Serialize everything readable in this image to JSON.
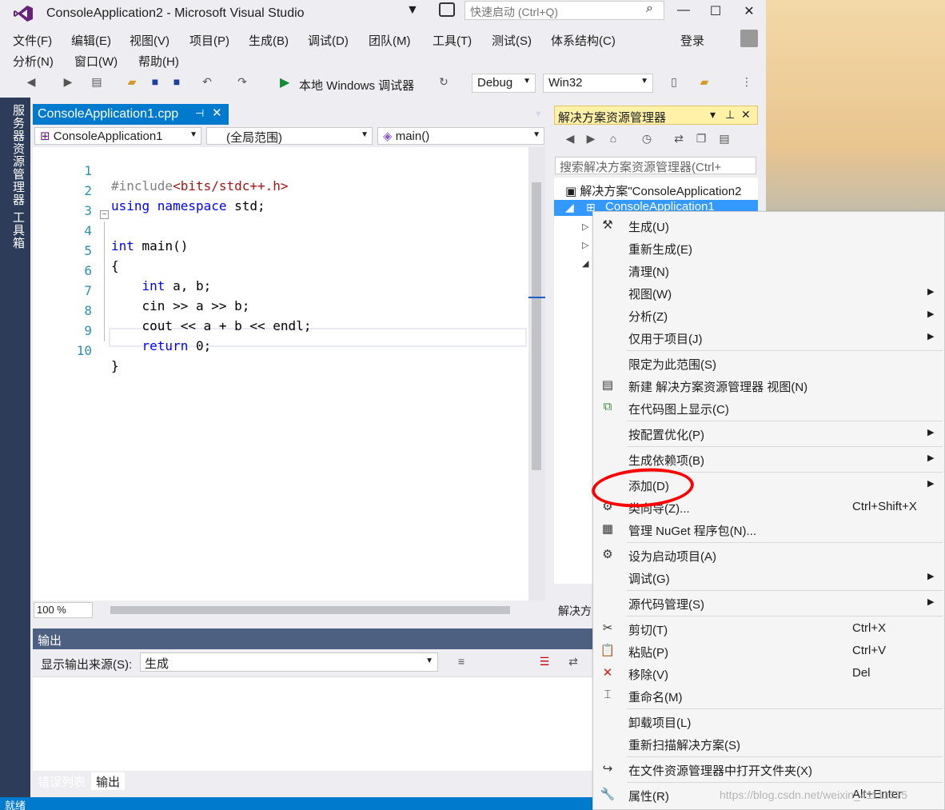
{
  "window": {
    "title": "ConsoleApplication2 - Microsoft Visual Studio",
    "quick_launch_placeholder": "快速启动 (Ctrl+Q)",
    "min": "—",
    "max": "☐",
    "close": "✕"
  },
  "menu": {
    "row1": [
      "文件(F)",
      "编辑(E)",
      "视图(V)",
      "项目(P)",
      "生成(B)",
      "调试(D)",
      "团队(M)",
      "工具(T)",
      "测试(S)",
      "体系结构(C)"
    ],
    "row2": [
      "分析(N)",
      "窗口(W)",
      "帮助(H)"
    ],
    "login": "登录"
  },
  "toolbar": {
    "run_label": "本地 Windows 调试器",
    "config": "Debug",
    "platform": "Win32"
  },
  "left_strip": {
    "server_explorer": "服务器资源管理器",
    "toolbox": "工具箱"
  },
  "editor": {
    "tab": "ConsoleApplication1.cpp",
    "project_combo": "ConsoleApplication1",
    "scope_combo": "(全局范围)",
    "member_combo": "main()",
    "zoom": "100 %",
    "lines": [
      {
        "n": "1",
        "text": "#include<bits/stdc++.h>"
      },
      {
        "n": "2",
        "text": "using namespace std;"
      },
      {
        "n": "3",
        "text": ""
      },
      {
        "n": "4",
        "text": "int main()"
      },
      {
        "n": "5",
        "text": "{"
      },
      {
        "n": "6",
        "text": "    int a, b;"
      },
      {
        "n": "7",
        "text": "    cin >> a >> b;"
      },
      {
        "n": "8",
        "text": "    cout << a + b << endl;"
      },
      {
        "n": "9",
        "text": "    return 0;"
      },
      {
        "n": "10",
        "text": "}"
      }
    ]
  },
  "output": {
    "title": "输出",
    "source_label": "显示输出来源(S):",
    "source_value": "生成",
    "tabs": [
      "错误列表",
      "输出"
    ]
  },
  "status": {
    "text": "就绪"
  },
  "solution_explorer": {
    "title": "解决方案资源管理器",
    "search_placeholder": "搜索解决方案资源管理器(Ctrl+",
    "solution_item": "解决方案\"ConsoleApplication2",
    "project_item": "ConsoleApplication1",
    "bottom_tab": "解决方"
  },
  "context_menu": {
    "items": [
      {
        "label": "生成(U)",
        "shortcut": "",
        "submenu": false,
        "icon": "build-icon"
      },
      {
        "label": "重新生成(E)",
        "shortcut": "",
        "submenu": false,
        "icon": ""
      },
      {
        "label": "清理(N)",
        "shortcut": "",
        "submenu": false,
        "icon": ""
      },
      {
        "label": "视图(W)",
        "shortcut": "",
        "submenu": true,
        "icon": ""
      },
      {
        "label": "分析(Z)",
        "shortcut": "",
        "submenu": true,
        "icon": ""
      },
      {
        "label": "仅用于项目(J)",
        "shortcut": "",
        "submenu": true,
        "icon": ""
      },
      {
        "label": "限定为此范围(S)",
        "shortcut": "",
        "submenu": false,
        "icon": ""
      },
      {
        "label": "新建 解决方案资源管理器 视图(N)",
        "shortcut": "",
        "submenu": false,
        "icon": "new-view-icon"
      },
      {
        "label": "在代码图上显示(C)",
        "shortcut": "",
        "submenu": false,
        "icon": "code-map-icon"
      },
      {
        "label": "按配置优化(P)",
        "shortcut": "",
        "submenu": true,
        "icon": ""
      },
      {
        "label": "生成依赖项(B)",
        "shortcut": "",
        "submenu": true,
        "icon": ""
      },
      {
        "label": "添加(D)",
        "shortcut": "",
        "submenu": true,
        "icon": ""
      },
      {
        "label": "类向导(Z)...",
        "shortcut": "Ctrl+Shift+X",
        "submenu": false,
        "icon": "class-wizard-icon"
      },
      {
        "label": "管理 NuGet 程序包(N)...",
        "shortcut": "",
        "submenu": false,
        "icon": "nuget-icon"
      },
      {
        "label": "设为启动项目(A)",
        "shortcut": "",
        "submenu": false,
        "icon": "gear-icon"
      },
      {
        "label": "调试(G)",
        "shortcut": "",
        "submenu": true,
        "icon": ""
      },
      {
        "label": "源代码管理(S)",
        "shortcut": "",
        "submenu": true,
        "icon": ""
      },
      {
        "label": "剪切(T)",
        "shortcut": "Ctrl+X",
        "submenu": false,
        "icon": "cut-icon"
      },
      {
        "label": "粘贴(P)",
        "shortcut": "Ctrl+V",
        "submenu": false,
        "icon": "paste-icon"
      },
      {
        "label": "移除(V)",
        "shortcut": "Del",
        "submenu": false,
        "icon": "remove-icon"
      },
      {
        "label": "重命名(M)",
        "shortcut": "",
        "submenu": false,
        "icon": "rename-icon"
      },
      {
        "label": "卸载项目(L)",
        "shortcut": "",
        "submenu": false,
        "icon": ""
      },
      {
        "label": "重新扫描解决方案(S)",
        "shortcut": "",
        "submenu": false,
        "icon": ""
      },
      {
        "label": "在文件资源管理器中打开文件夹(X)",
        "shortcut": "",
        "submenu": false,
        "icon": "open-folder-icon"
      },
      {
        "label": "属性(R)",
        "shortcut": "Alt+Enter",
        "submenu": false,
        "icon": "wrench-icon"
      }
    ]
  },
  "watermark": "https://blog.csdn.net/weixin_41111525",
  "colors": {
    "accent": "#007acc",
    "annotation": "#ff0000",
    "selection": "#3399ff"
  }
}
